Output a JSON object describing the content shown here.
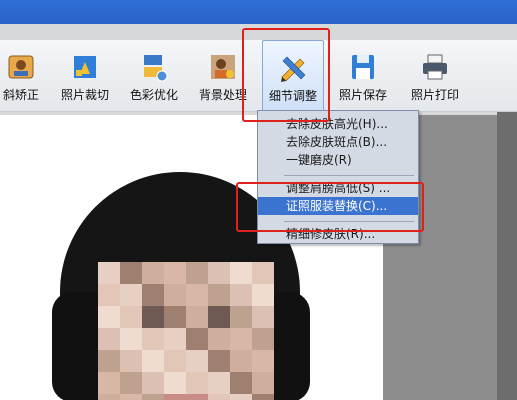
{
  "toolbar": {
    "items": [
      {
        "label": "斜矫正",
        "icon": "tilt-correct-icon"
      },
      {
        "label": "照片裁切",
        "icon": "crop-icon"
      },
      {
        "label": "色彩优化",
        "icon": "color-optimize-icon"
      },
      {
        "label": "背景处理",
        "icon": "background-icon"
      },
      {
        "label": "细节调整",
        "icon": "pencil-ruler-icon"
      },
      {
        "label": "照片保存",
        "icon": "floppy-disk-icon"
      },
      {
        "label": "照片打印",
        "icon": "printer-icon"
      }
    ]
  },
  "menu": {
    "items": [
      "去除皮肤高光(H)...",
      "去除皮肤斑点(B)...",
      "一键磨皮(R)",
      "调整肩膀高低(S) ...",
      "证照服装替换(C)...",
      "精细修皮肤(R)..."
    ]
  },
  "colors": {
    "accent": "#3b74d0",
    "highlight_box": "#e0201a"
  }
}
